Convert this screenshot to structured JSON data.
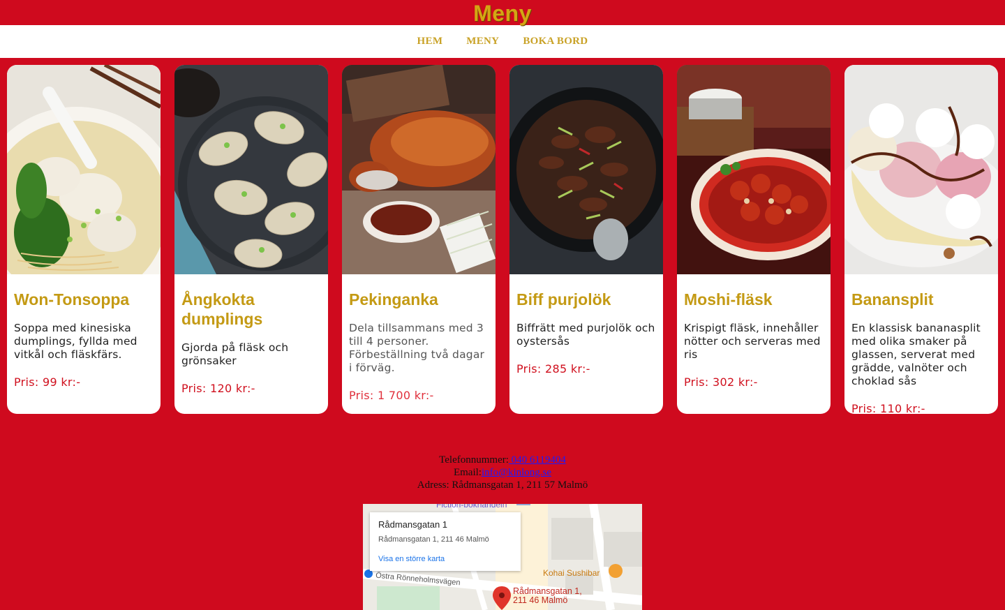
{
  "header": {
    "title": "Meny"
  },
  "nav": {
    "items": [
      "HEM",
      "MENY",
      "BOKA BORD"
    ]
  },
  "menu": [
    {
      "title": "Won-Tonsoppa",
      "desc": "Soppa med kinesiska dumplings, fyllda med vitkål och fläskfärs.",
      "price": "Pris: 99 kr:-",
      "image": "wonton-soup"
    },
    {
      "title": "Ångkokta dumplings",
      "desc": "Gjorda på fläsk och grönsaker",
      "price": "Pris: 120 kr:-",
      "image": "steamed-dumplings"
    },
    {
      "title": "Pekinganka",
      "desc": "Dela tillsammans med 3 till 4 personer. Förbeställning två dagar i förväg.",
      "price": "Pris: 1 700 kr:-",
      "image": "peking-duck"
    },
    {
      "title": "Biff purjolök",
      "desc": "Biffrätt med purjolök och oystersås",
      "price": "Pris: 285 kr:-",
      "image": "beef-leek"
    },
    {
      "title": "Moshi-fläsk",
      "desc": "Krispigt fläsk, innehåller nötter och serveras med ris",
      "price": "Pris: 302 kr:-",
      "image": "moshi-pork"
    },
    {
      "title": "Banansplit",
      "desc": "En klassisk bananasplit med olika smaker på glassen, serverat med grädde, valnöter och choklad sås",
      "price": "Pris: 110 kr:-",
      "image": "banana-split"
    }
  ],
  "contact": {
    "phone_label": "Telefonnummer:",
    "phone": " 040 6119404",
    "email_label": "Email:",
    "email": "info@kinlong.se",
    "address": "Adress: Rådmansgatan 1, 211 57 Malmö"
  },
  "map": {
    "card_title": "Rådmansgatan 1",
    "card_address": "Rådmansgatan 1, 211 46 Malmö",
    "card_link": "Visa en större karta",
    "pin_line1": "Rådmansgatan 1,",
    "pin_line2": "211 46 Malmö",
    "poi_1": "Fiction-bokhandeln",
    "poi_2": "Kohai Sushibar",
    "street": "Östra Rönneholmsvägen"
  }
}
